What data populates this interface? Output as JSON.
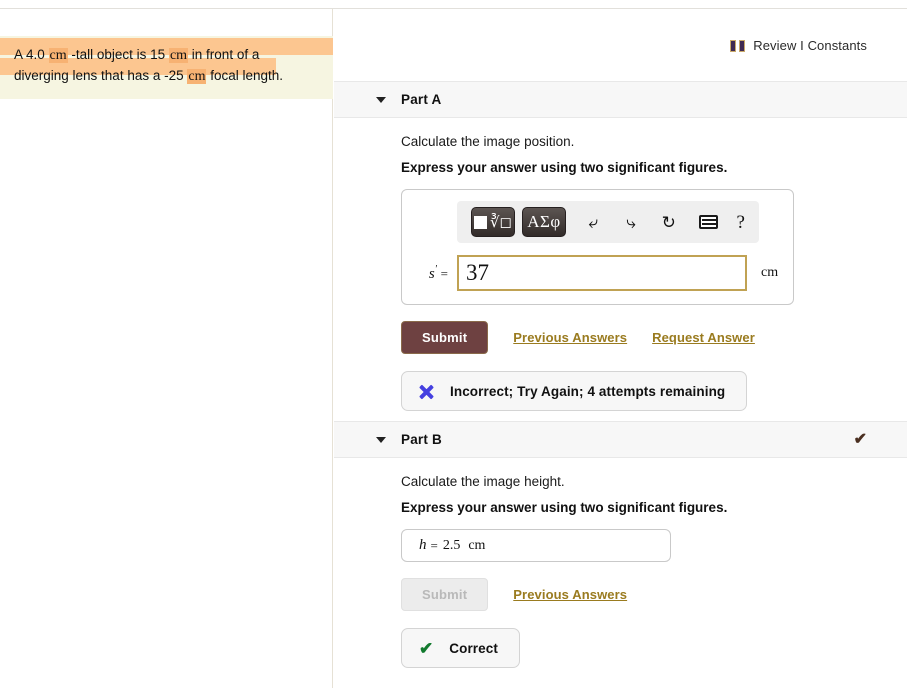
{
  "problem": {
    "line1_pre": "A 4.0 ",
    "line1_unit": "cm",
    "line1_mid": " -tall object is 15 ",
    "line1_unit2": "cm",
    "line1_post": " in front of a",
    "line2_pre": "diverging lens that has a -25 ",
    "line2_unit": "cm",
    "line2_post": " focal length.",
    "highlight_color": "#fcc690",
    "background_color": "#f6f5e1"
  },
  "header": {
    "review_label": "Review I Constants",
    "book_icon": "book-icon"
  },
  "parts": [
    {
      "id": "a",
      "title": "Part A",
      "caret_icon": "caret-down-icon",
      "status_icon": "",
      "question": "Calculate the image position.",
      "emphasis": "Express your answer using two significant figures.",
      "toolbar": {
        "template_button": "template-icon",
        "greek_button": "ΑΣφ",
        "undo_icon": "undo-arrow-icon",
        "redo_icon": "redo-arrow-icon",
        "reset_icon": "reset-circle-icon",
        "keyboard_icon": "keyboard-icon",
        "help_label": "?"
      },
      "input": {
        "label_var": "s",
        "label_prime": "′",
        "label_eq": "=",
        "value": "37",
        "placeholder": "",
        "unit": "cm",
        "border_color": "#c0a253"
      },
      "submit_label": "Submit",
      "submit_disabled": false,
      "links": [
        "Previous Answers",
        "Request Answer"
      ],
      "feedback": {
        "icon": "x-mark-icon",
        "icon_color": "#4540e0",
        "text": "Incorrect; Try Again; 4 attempts remaining"
      }
    },
    {
      "id": "b",
      "title": "Part B",
      "caret_icon": "caret-down-icon",
      "status_icon": "✔",
      "status_color": "#4a2f20",
      "question": "Calculate the image height.",
      "emphasis": "Express your answer using two significant figures.",
      "answer": {
        "label_var": "h",
        "label_eq": "=",
        "value": "2.5",
        "unit": "cm"
      },
      "submit_label": "Submit",
      "submit_disabled": true,
      "links": [
        "Previous Answers"
      ],
      "feedback": {
        "icon": "✔",
        "icon_color": "#127a2e",
        "text": "Correct"
      }
    }
  ]
}
